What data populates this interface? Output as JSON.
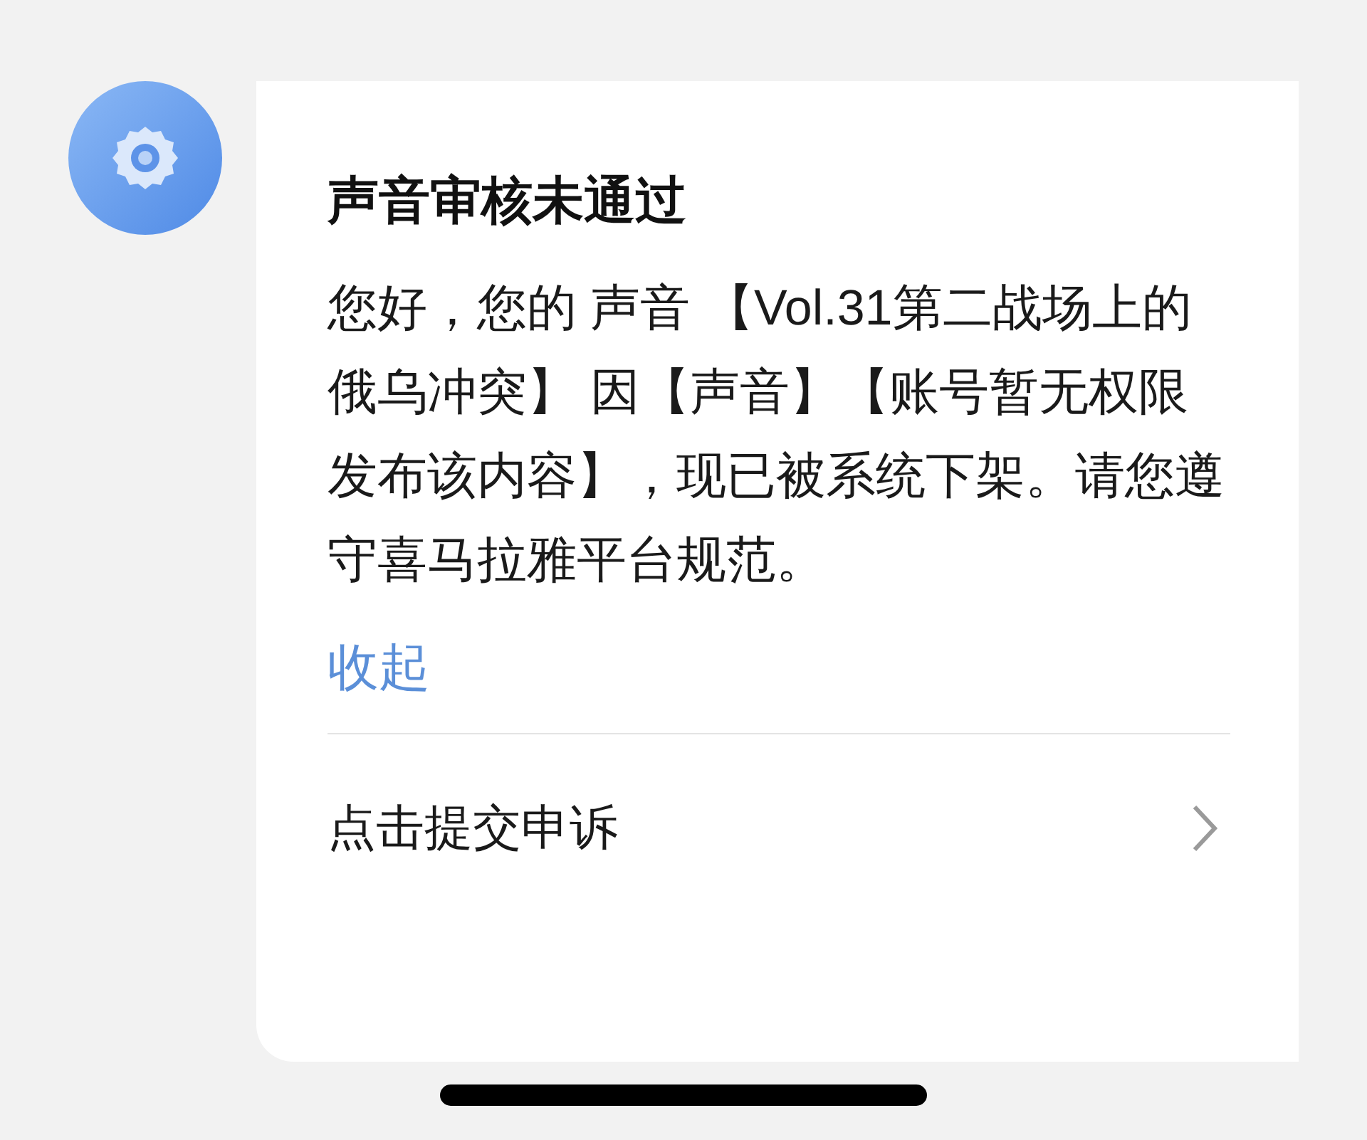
{
  "notice": {
    "title": "声音审核未通过",
    "message": "您好，您的 声音 【Vol.31第二战场上的俄乌冲突】 因【声音】【账号暂无权限发布该内容】，现已被系统下架。请您遵守喜马拉雅平台规范。",
    "collapse_link": "收起",
    "appeal_action": "点击提交申诉"
  }
}
